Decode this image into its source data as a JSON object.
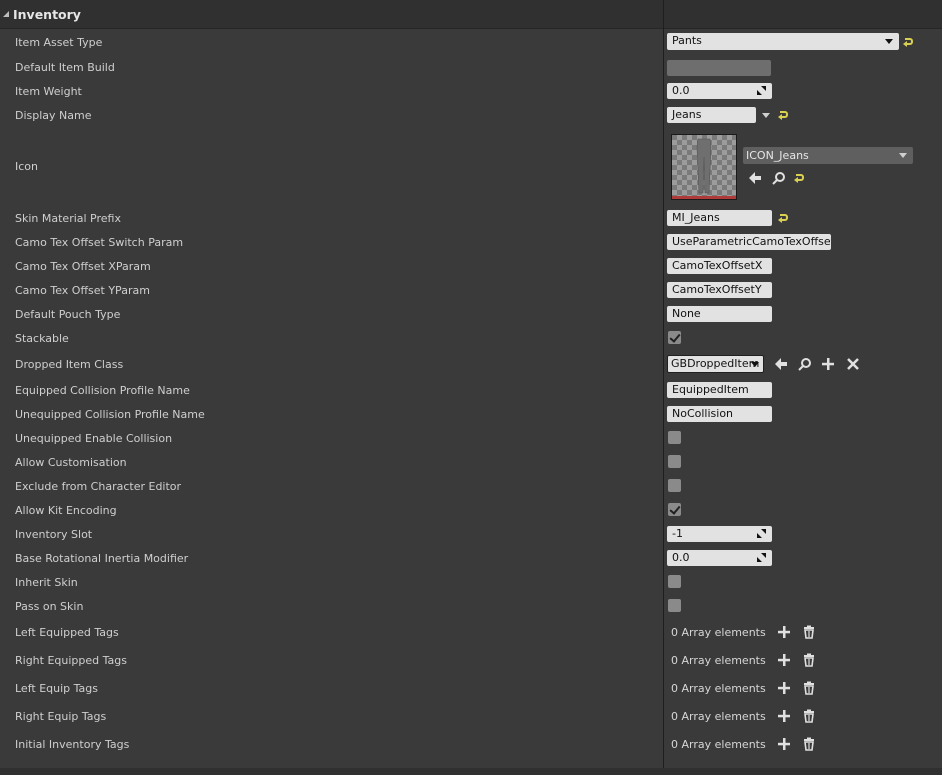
{
  "section": {
    "title": "Inventory"
  },
  "labels": {
    "item_asset_type": "Item Asset Type",
    "default_item_build": "Default Item Build",
    "item_weight": "Item Weight",
    "display_name": "Display Name",
    "icon": "Icon",
    "skin_material_prefix": "Skin Material Prefix",
    "camo_switch": "Camo Tex Offset Switch Param",
    "camo_x": "Camo Tex Offset XParam",
    "camo_y": "Camo Tex Offset YParam",
    "pouch": "Default Pouch Type",
    "stackable": "Stackable",
    "dropped_item_class": "Dropped Item Class",
    "equipped_collision": "Equipped Collision Profile Name",
    "unequipped_collision": "Unequipped Collision Profile Name",
    "unequipped_enable": "Unequipped Enable Collision",
    "allow_custom": "Allow Customisation",
    "exclude_editor": "Exclude from Character Editor",
    "allow_kit": "Allow Kit Encoding",
    "inventory_slot": "Inventory Slot",
    "base_inertia": "Base Rotational Inertia Modifier",
    "inherit_skin": "Inherit Skin",
    "pass_skin": "Pass on Skin",
    "left_equipped_tags": "Left Equipped Tags",
    "right_equipped_tags": "Right Equipped Tags",
    "left_equip_tags": "Left Equip Tags",
    "right_equip_tags": "Right Equip Tags",
    "initial_inventory_tags": "Initial Inventory Tags"
  },
  "values": {
    "item_asset_type": "Pants",
    "item_weight": "0.0",
    "display_name": "Jeans",
    "icon_asset": "ICON_Jeans",
    "skin_material_prefix": "MI_Jeans",
    "camo_switch": "UseParametricCamoTexOffset",
    "camo_x": "CamoTexOffsetX",
    "camo_y": "CamoTexOffsetY",
    "pouch": "None",
    "dropped_item_class": "GBDroppedItem",
    "equipped_collision": "EquippedItem",
    "unequipped_collision": "NoCollision",
    "inventory_slot": "-1",
    "base_inertia": "0.0",
    "array_text": "0 Array elements"
  },
  "checkboxes": {
    "stackable": true,
    "unequipped_enable": false,
    "allow_custom": false,
    "exclude_editor": false,
    "allow_kit": true,
    "inherit_skin": false,
    "pass_skin": false
  },
  "icons": [
    "reset-arrow-icon",
    "spinner-icon",
    "use-selected-arrow-icon",
    "browse-magnifier-icon",
    "add-plus-icon",
    "clear-x-icon",
    "trash-icon",
    "dropdown-caret-icon",
    "checkmark-icon"
  ],
  "colors": {
    "background": "#3a3a3a",
    "field": "#e2e2e2",
    "reset_accent": "#d9cf53",
    "thumb_bar": "#b03a3a"
  }
}
